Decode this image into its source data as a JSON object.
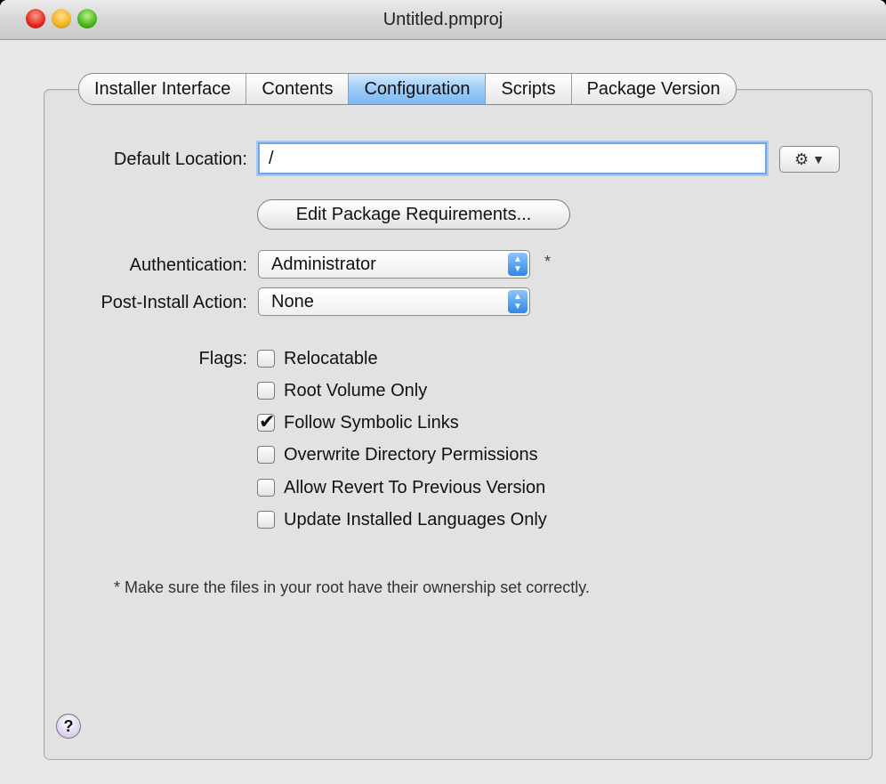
{
  "window": {
    "title": "Untitled.pmproj"
  },
  "tabs": [
    {
      "label": "Installer Interface",
      "selected": false
    },
    {
      "label": "Contents",
      "selected": false
    },
    {
      "label": "Configuration",
      "selected": true
    },
    {
      "label": "Scripts",
      "selected": false
    },
    {
      "label": "Package Version",
      "selected": false
    }
  ],
  "form": {
    "default_location_label": "Default Location:",
    "default_location_value": "/",
    "gear_icon": "gear-icon",
    "edit_requirements_label": "Edit Package Requirements...",
    "authentication_label": "Authentication:",
    "authentication_value": "Administrator",
    "asterisk": "*",
    "post_install_label": "Post-Install Action:",
    "post_install_value": "None",
    "flags_label": "Flags:",
    "flags": [
      {
        "label": "Relocatable",
        "checked": false
      },
      {
        "label": "Root Volume Only",
        "checked": false
      },
      {
        "label": "Follow Symbolic Links",
        "checked": true
      },
      {
        "label": "Overwrite Directory Permissions",
        "checked": false
      },
      {
        "label": "Allow Revert To Previous Version",
        "checked": false
      },
      {
        "label": "Update Installed Languages Only",
        "checked": false
      }
    ],
    "note": "* Make sure the files in your root have their ownership set correctly."
  },
  "help": {
    "label": "?"
  },
  "colors": {
    "selected_tab": "#9ecbf7",
    "focus_ring": "#6fa6e6",
    "popup_arrows": "#2f86e4"
  }
}
